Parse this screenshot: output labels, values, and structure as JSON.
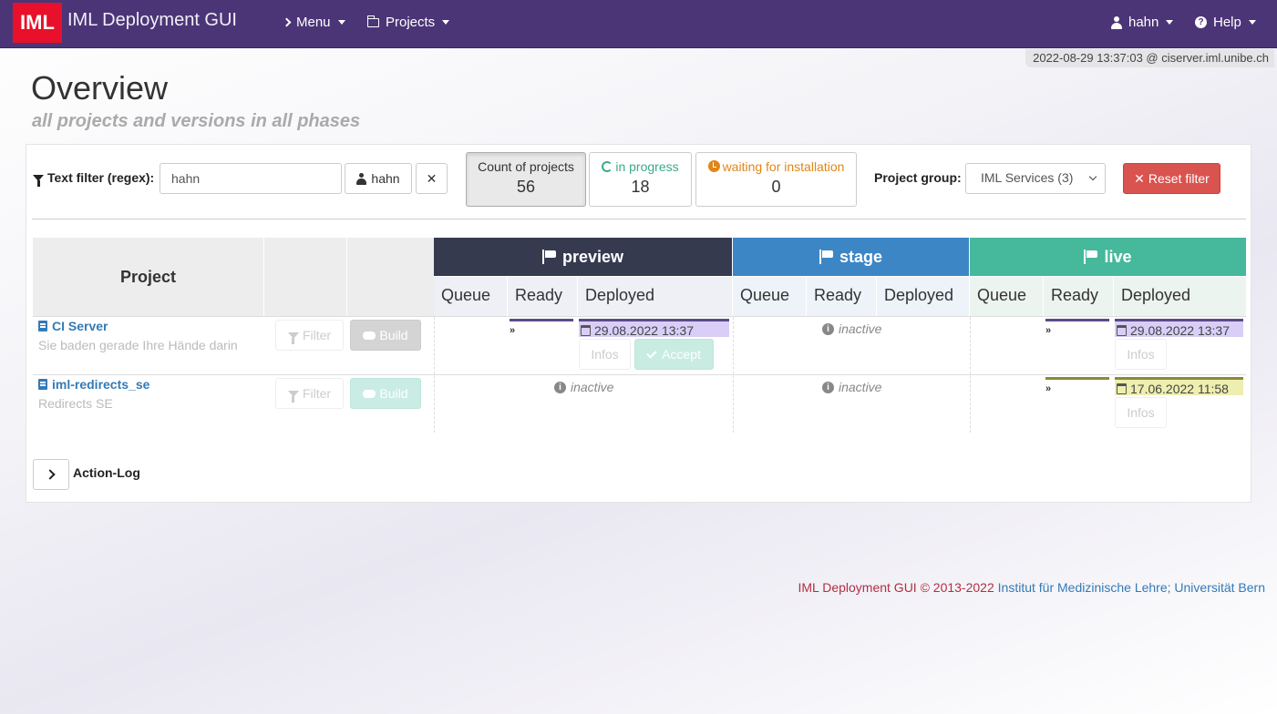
{
  "navbar": {
    "logo": "IML",
    "title": "IML Deployment GUI",
    "menu": "Menu",
    "projects": "Projects",
    "user": "hahn",
    "help": "Help"
  },
  "server_info": "2022-08-29 13:37:03 @ ciserver.iml.unibe.ch",
  "page": {
    "title": "Overview",
    "subtitle": "all projects and versions in all phases"
  },
  "filter": {
    "label": "Text filter (regex):",
    "value": "hahn",
    "user_button": "hahn",
    "clear_button": "✕",
    "count_label": "Count of projects",
    "count_value": "56",
    "in_progress_label": "in progress",
    "in_progress_value": "18",
    "waiting_label": "waiting for installation",
    "waiting_value": "0",
    "group_label": "Project group:",
    "group_value": "IML Services (3)",
    "reset_label": "Reset filter"
  },
  "table": {
    "project_header": "Project",
    "phases": [
      {
        "name": "preview",
        "color": "#363a4f"
      },
      {
        "name": "stage",
        "color": "#3d86c6"
      },
      {
        "name": "live",
        "color": "#46b89b"
      }
    ],
    "sub_headers": {
      "queue": "Queue",
      "ready": "Ready",
      "deployed": "Deployed"
    },
    "filter_button": "Filter",
    "build_button": "Build",
    "infos_button": "Infos",
    "accept_button": "Accept",
    "inactive_label": "inactive",
    "ready_marker": "»",
    "rows": [
      {
        "name": "CI Server",
        "description": "Sie baden gerade Ihre Hände darin",
        "preview_deployed": "29.08.2022 13:37",
        "live_deployed": "29.08.2022 13:37"
      },
      {
        "name": "iml-redirects_se",
        "description": "Redirects SE",
        "live_deployed": "17.06.2022 11:58"
      }
    ]
  },
  "action_log": "Action-Log",
  "footer": {
    "text": "IML Deployment GUI © 2013-2022",
    "link": "Institut für Medizinische Lehre; Universität Bern"
  },
  "colors": {
    "navbar": "#4b3577",
    "logo": "#e8102a",
    "reset": "#d9534f",
    "chip_purple": "#d9cef7",
    "chip_yellow": "#eeeeb0"
  }
}
